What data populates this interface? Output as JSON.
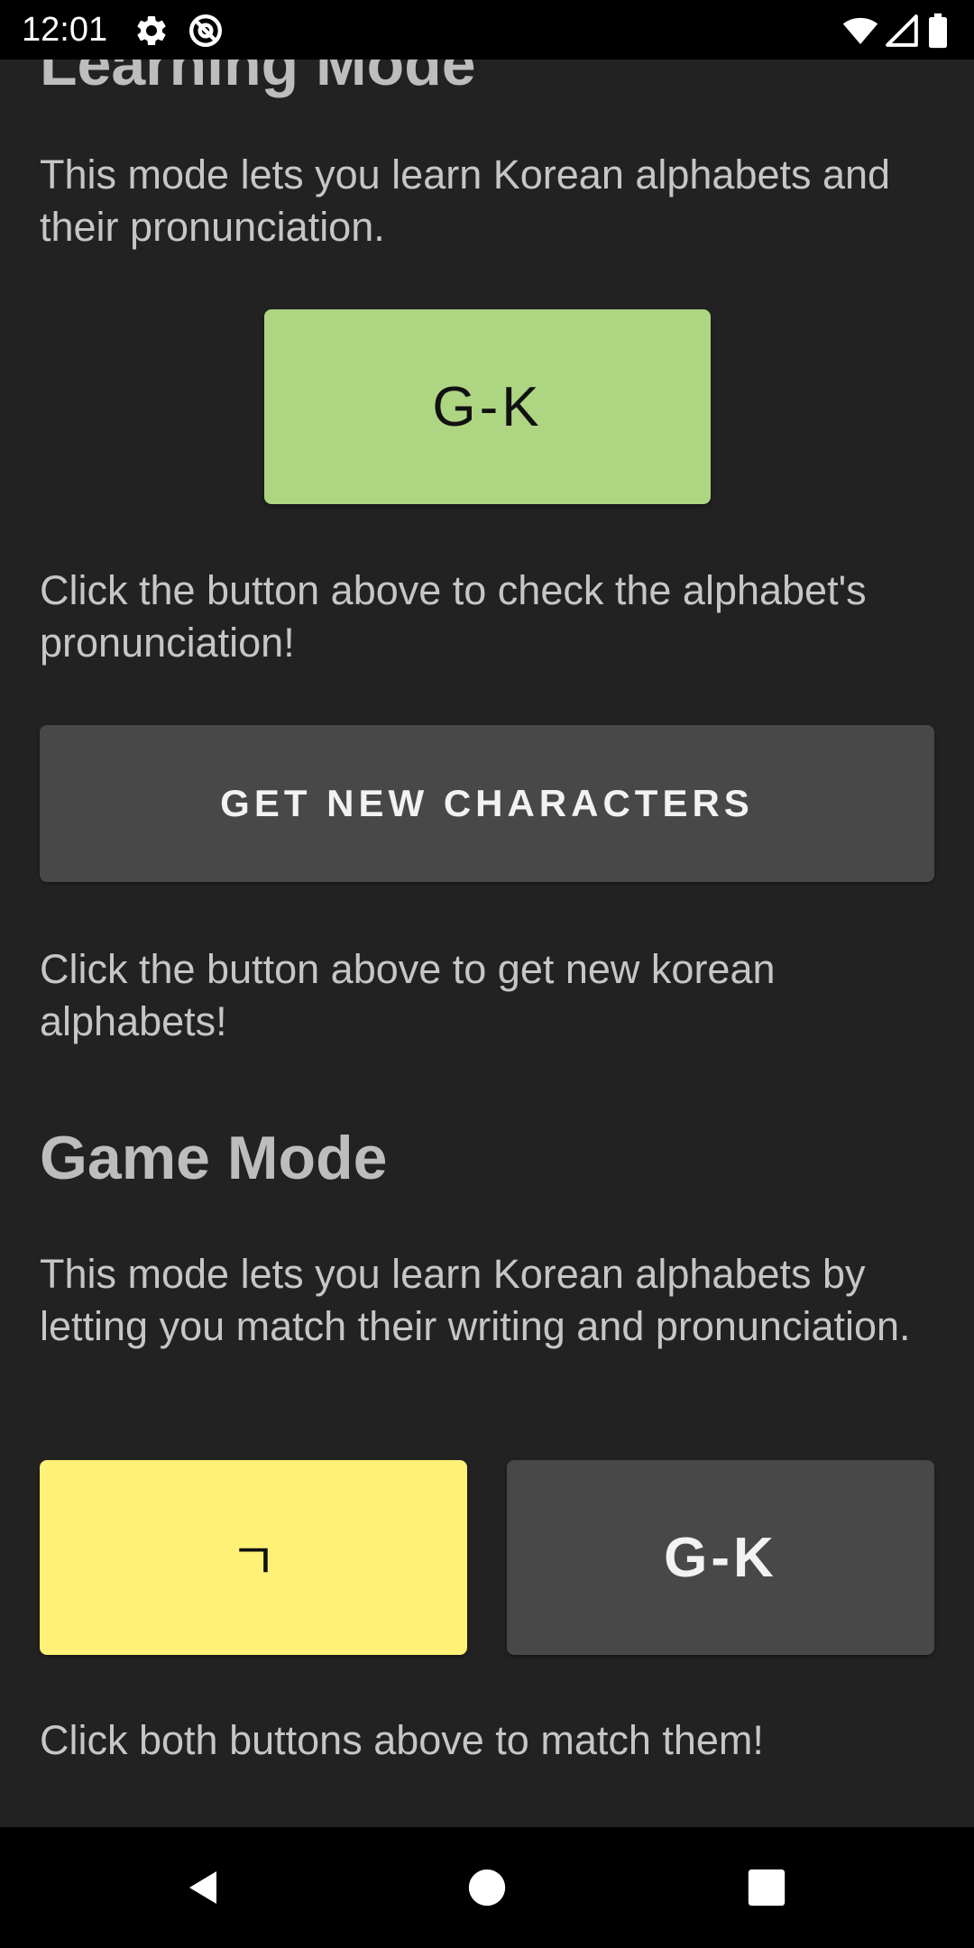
{
  "status_bar": {
    "time": "12:01",
    "icons": [
      "gear-icon",
      "at-sign-icon",
      "wifi-icon",
      "signal-icon",
      "battery-icon"
    ]
  },
  "learning_mode": {
    "title": "Learning Mode",
    "description": "This mode lets you learn Korean alphabets and their pronunciation.",
    "pronunciation_button_label": "G-K",
    "pronunciation_hint": "Click the button above to check the alphabet's pronunciation!",
    "new_characters_button_label": "GET NEW CHARACTERS",
    "new_characters_hint": "Click the button above to get new korean alphabets!"
  },
  "game_mode": {
    "title": "Game Mode",
    "description": "This mode lets you learn Korean alphabets by letting you match their writing and pronunciation.",
    "character_button_label": "ㄱ",
    "pronunciation_button_label": "G-K",
    "hint": "Click both buttons above to match them!"
  },
  "navigation_bar": {
    "icons": [
      "back-icon",
      "home-icon",
      "recents-icon"
    ]
  },
  "colors": {
    "background": "#222222",
    "green_button": "#aed581",
    "yellow_button": "#fff176",
    "gray_button": "#484848"
  }
}
